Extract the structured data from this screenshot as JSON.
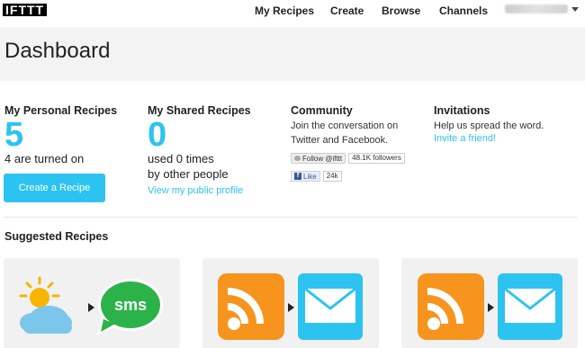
{
  "logo": {
    "text": "IFTTT"
  },
  "nav": {
    "items": [
      "My Recipes",
      "Create",
      "Browse",
      "Channels"
    ]
  },
  "user": {
    "name": "",
    "icon": "caret-down-icon"
  },
  "header": {
    "title": "Dashboard"
  },
  "personal": {
    "heading": "My Personal Recipes",
    "count": "5",
    "status": "4 are turned on",
    "button": "Create a Recipe"
  },
  "shared": {
    "heading": "My Shared Recipes",
    "count": "0",
    "line1": "used 0 times",
    "line2": "by other people",
    "link": "View my public profile"
  },
  "community": {
    "heading": "Community",
    "line1": "Join the conversation on",
    "line2": "Twitter and Facebook.",
    "twitter_button": "Follow @ifttt",
    "twitter_count": "48.1K followers",
    "facebook_button": "Like",
    "facebook_count": "24k"
  },
  "invitations": {
    "heading": "Invitations",
    "text": "Help us spread the word.",
    "link": "Invite a friend!"
  },
  "suggested": {
    "title": "Suggested Recipes",
    "cards": [
      {
        "trigger": "weather-icon",
        "action": "sms-icon",
        "action_label": "sms"
      },
      {
        "trigger": "rss-icon",
        "action": "email-icon"
      },
      {
        "trigger": "rss-icon",
        "action": "email-icon"
      }
    ]
  },
  "colors": {
    "accent": "#2dc3f0",
    "rss": "#f7941d",
    "sms": "#2bb34a",
    "header_bg": "#f3f3f3"
  }
}
